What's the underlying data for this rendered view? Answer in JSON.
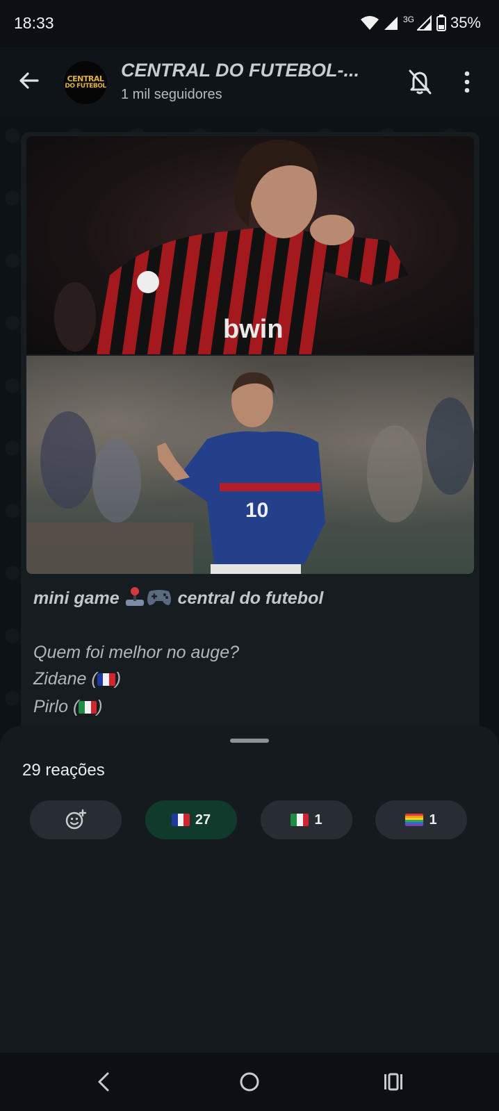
{
  "status_bar": {
    "time": "18:33",
    "network": "3G",
    "battery": "35%"
  },
  "header": {
    "avatar_text_line1": "CENTRAL",
    "avatar_text_line2": "DO FUTEBOL",
    "title": "CENTRAL DO FUTEBOL-...",
    "subtitle": "1 mil seguidores",
    "icons": [
      "back-arrow-icon",
      "bell-off-icon",
      "more-vert-icon"
    ]
  },
  "message": {
    "images": [
      "pirlo-photo",
      "zidane-photo"
    ],
    "photo_text": {
      "jersey_sponsor": "bwin",
      "jersey_number": "10"
    },
    "caption_title_part1": "mini game",
    "caption_title_part2": "central do futebol",
    "question": "Quem foi melhor no auge?",
    "option1_name": "Zidane",
    "option2_name": "Pirlo"
  },
  "reactions_sheet": {
    "title": "29 reações",
    "reactions": [
      {
        "emoji": "add-reaction-icon",
        "count": ""
      },
      {
        "emoji": "france-flag",
        "count": "27"
      },
      {
        "emoji": "italy-flag",
        "count": "1"
      },
      {
        "emoji": "rainbow-flag",
        "count": "1"
      }
    ]
  },
  "nav_bar": {
    "icons": [
      "nav-back-icon",
      "nav-home-icon",
      "nav-recents-icon"
    ]
  },
  "colors": {
    "active_reaction_bg": "#103a2c",
    "reaction_bg": "#272d33",
    "sheet_bg": "#151a1e",
    "avatar_text": "#e2b23c"
  }
}
